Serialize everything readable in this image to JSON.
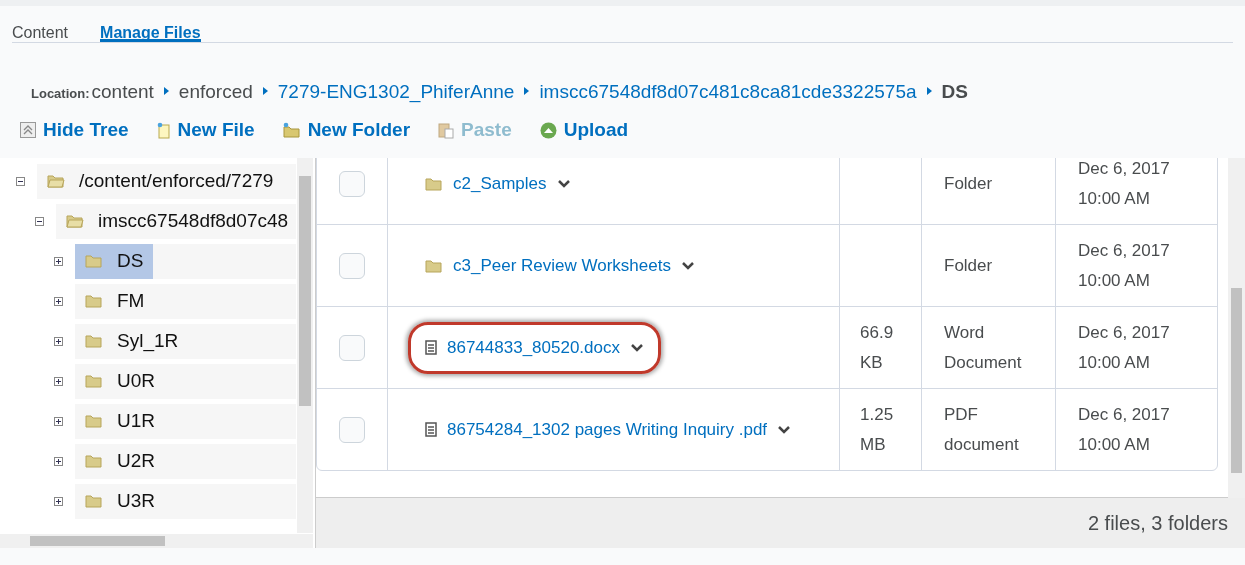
{
  "tabs": [
    {
      "label": "Content",
      "selected": false
    },
    {
      "label": "Manage Files",
      "selected": true
    }
  ],
  "location": {
    "label": "Location:",
    "crumbs": [
      {
        "text": "content",
        "link": false
      },
      {
        "text": "enforced",
        "link": false
      },
      {
        "text": "7279-ENG1302_PhiferAnne",
        "link": true
      },
      {
        "text": "imscc67548df8d07c481c8ca81cde3322575a",
        "link": true
      },
      {
        "text": "DS",
        "link": false
      }
    ]
  },
  "toolbar": [
    {
      "label": "Hide Tree",
      "kind": "hide",
      "disabled": false
    },
    {
      "label": "New File",
      "kind": "newfile",
      "disabled": false
    },
    {
      "label": "New Folder",
      "kind": "newfolder",
      "disabled": false
    },
    {
      "label": "Paste",
      "kind": "paste",
      "disabled": true
    },
    {
      "label": "Upload",
      "kind": "upload",
      "disabled": false
    }
  ],
  "tree": [
    {
      "label": "/content/enforced/7279",
      "expanded": true,
      "selected": false,
      "children": [
        {
          "label": "imscc67548df8d07c48",
          "expanded": true,
          "selected": false,
          "children": [
            {
              "label": "DS",
              "expanded": false,
              "selected": true
            },
            {
              "label": "FM",
              "expanded": false,
              "selected": false
            },
            {
              "label": "Syl_1R",
              "expanded": false,
              "selected": false
            },
            {
              "label": "U0R",
              "expanded": false,
              "selected": false
            },
            {
              "label": "U1R",
              "expanded": false,
              "selected": false
            },
            {
              "label": "U2R",
              "expanded": false,
              "selected": false
            },
            {
              "label": "U3R",
              "expanded": false,
              "selected": false
            }
          ]
        }
      ]
    }
  ],
  "files": [
    {
      "kind": "folder",
      "name": "c2_Samples",
      "type": "Folder",
      "date": "Dec 6, 2017",
      "time": "10:00 AM",
      "checked": false,
      "highlighted": false
    },
    {
      "kind": "folder",
      "name": "c3_Peer Review Worksheets",
      "type": "Folder",
      "date": "Dec 6, 2017",
      "time": "10:00 AM",
      "checked": false,
      "highlighted": false
    },
    {
      "kind": "file",
      "name": "86744833_80520.docx",
      "size": "66.9 KB",
      "type": "Word Document",
      "date": "Dec 6, 2017",
      "time": "10:00 AM",
      "checked": false,
      "highlighted": true
    },
    {
      "kind": "file",
      "name": "86754284_1302 pages Writing Inquiry .pdf",
      "size": "1.25 MB",
      "type": "PDF document",
      "date": "Dec 6, 2017",
      "time": "10:00 AM",
      "checked": false,
      "highlighted": false
    }
  ],
  "summary": "2 files, 3 folders"
}
